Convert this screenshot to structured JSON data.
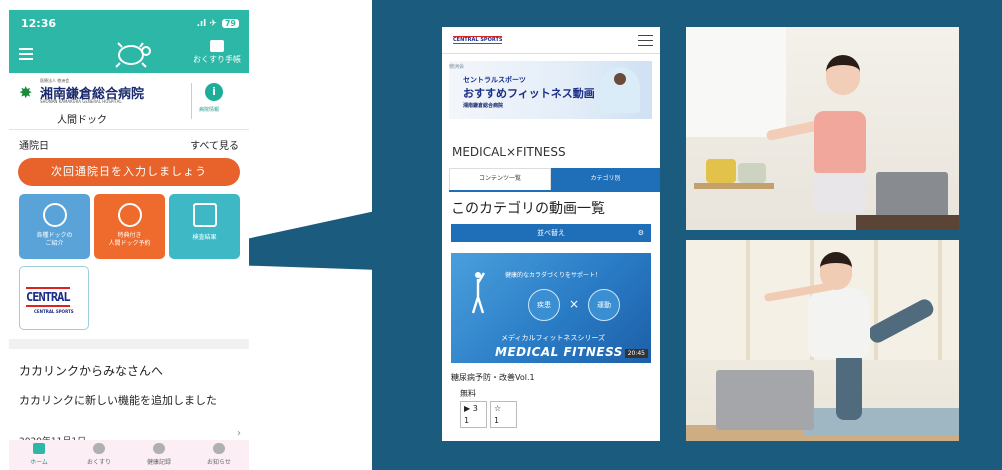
{
  "phone": {
    "status_time": "12:36",
    "status_right": ".ıl ✈",
    "battery": "79",
    "appbar_right_label": "おくすり手帳",
    "hospital_small_top": "医療法人 徳洲会",
    "hospital_name": "湘南鎌倉総合病院",
    "hospital_sub": "SHONAN KAMAKURA GENERAL HOSPITAL",
    "dock_label": "人間ドック",
    "info_label": "病院情報",
    "visit_label": "通院日",
    "see_all": "すべて見る",
    "cta": "次回通院日を入力しましょう",
    "tiles": [
      {
        "label": "各種ドックの\nご紹介"
      },
      {
        "label": "特典付き\n人間ドック予約"
      },
      {
        "label": "検査結果"
      }
    ],
    "central_logo": "CENTRAL",
    "central_sub": "CENTRAL SPORTS",
    "section_title": "カカリンクからみなさんへ",
    "message": "カカリンクに新しい機能を追加しました",
    "date": "2020年11月1日",
    "tabs": [
      {
        "label": "ホーム"
      },
      {
        "label": "おくすり"
      },
      {
        "label": "健康記録"
      },
      {
        "label": "お知らせ"
      }
    ]
  },
  "site": {
    "logo": "CENTRAL SPORTS",
    "banner_line1": "セントラルスポーツ",
    "banner_line2": "おすすめフィットネス動画",
    "banner_hospital": "湘南鎌倉総合病院",
    "banner_top_small": "徳洲会",
    "title": "MEDICAL×FITNESS",
    "tab_contents": "コンテンツ一覧",
    "tab_category": "カテゴリ別",
    "category_heading": "このカテゴリの動画一覧",
    "sort_label": "並べ替え",
    "video_tagline": "健康的なカラダづくりをサポート！",
    "pill_1": "疾患",
    "pill_x": "×",
    "pill_2": "運動",
    "series_label": "メディカルフィットネスシリーズ",
    "video_title_big": "MEDICAL FITNESS",
    "duration": "20:45",
    "video_caption": "糖尿病予防・改善Vol.1",
    "price": "無料",
    "stat_play": "▶ 3\n1",
    "stat_star": "☆\n1"
  },
  "colors": {
    "teal": "#2db7a7",
    "orange": "#e8632b",
    "navy_panel": "#1b5b7e",
    "site_blue": "#1f6fb8"
  }
}
